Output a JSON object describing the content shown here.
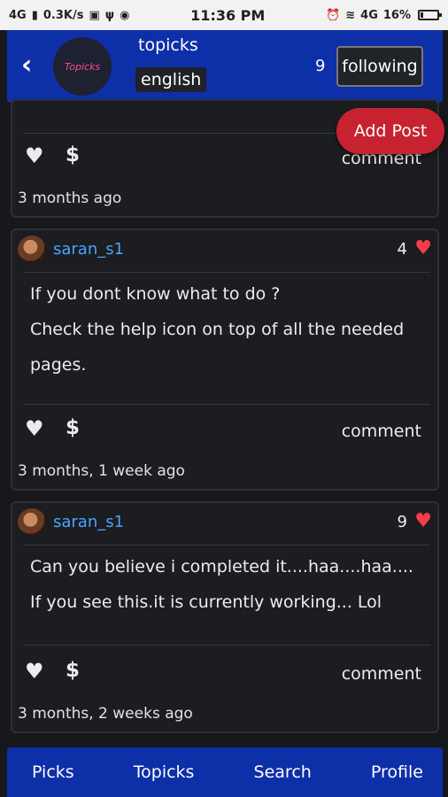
{
  "status_bar": {
    "network": "4G",
    "speed": "0.3K/s",
    "time": "11:36 PM",
    "volte": "4G",
    "battery": "16%",
    "battery_level": 0.16
  },
  "header": {
    "back_icon": "chevron-left-icon",
    "logo_text": "Topicks",
    "topic": "topicks",
    "language": "english",
    "follow_count": "9",
    "follow_label": "following"
  },
  "add_post_label": "Add Post",
  "posts": [
    {
      "comment_label": "comment",
      "time": "3 months ago"
    },
    {
      "user": "saran_s1",
      "likes": "4",
      "lines": [
        "If you dont know what to do ?",
        "Check the help icon on top of all the needed",
        "pages."
      ],
      "comment_label": "comment",
      "time": "3 months, 1 week ago"
    },
    {
      "user": "saran_s1",
      "likes": "9",
      "lines": [
        "Can you believe i completed it....haa....haa....",
        "If you see this.it is currently working... Lol"
      ],
      "comment_label": "comment",
      "time": "3 months, 2 weeks ago"
    }
  ],
  "nav": [
    "Picks",
    "Topicks",
    "Search",
    "Profile"
  ],
  "colors": {
    "header_bg": "#0d2fa8",
    "username": "#4aa3ff",
    "heart": "#ff3b47",
    "add_post_bg": "#c7222f"
  }
}
